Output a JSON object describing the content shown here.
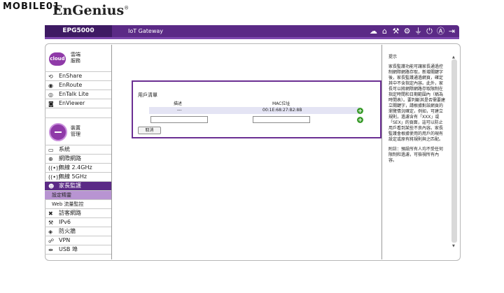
{
  "header": {
    "watermark": "MOBILE01",
    "logo_text": "EnGenius",
    "logo_mark": "®",
    "model": "EPG5000",
    "product": "IoT Gateway",
    "icons": [
      "cloud-download-icon",
      "home-icon",
      "tools-icon",
      "gear-icon",
      "plug-icon",
      "power-icon",
      "circled-a-icon",
      "logout-icon"
    ]
  },
  "sidebar": {
    "cloud_section": {
      "badge": "cloud",
      "title_line1": "雲端",
      "title_line2": "服務"
    },
    "cloud_items": [
      {
        "label": "EnShare",
        "icon": "share-icon"
      },
      {
        "label": "EnRoute",
        "icon": "route-icon"
      },
      {
        "label": "EnTalk Lite",
        "icon": "talk-icon"
      },
      {
        "label": "EnViewer",
        "icon": "camera-icon"
      }
    ],
    "device_section": {
      "title_line1": "裝置",
      "title_line2": "管理"
    },
    "device_items": [
      {
        "label": "系統",
        "icon": "monitor-icon"
      },
      {
        "label": "網際網路",
        "icon": "globe-icon"
      },
      {
        "label": "無線 2.4GHz",
        "icon": "wireless-icon"
      },
      {
        "label": "無線 5GHz",
        "icon": "wireless-icon"
      }
    ],
    "active_item": {
      "label": "家長監護",
      "icon": "users-icon"
    },
    "sub_items": [
      {
        "label": "設定精靈",
        "selected": true
      },
      {
        "label": "Web 流量監控",
        "selected": false
      }
    ],
    "more_items": [
      {
        "label": "訪客網路",
        "icon": "wrench-icon"
      },
      {
        "label": "IPv6",
        "icon": "tools-icon"
      },
      {
        "label": "防火牆",
        "icon": "firewall-icon"
      },
      {
        "label": "VPN",
        "icon": "vpn-icon"
      },
      {
        "label": "USB 埠",
        "icon": "usb-icon"
      }
    ]
  },
  "dialog": {
    "title": "用戶清單",
    "col_desc": "描述",
    "col_mac": "MAC位址",
    "row": {
      "desc": "---",
      "mac": "00:1E:68:27:B2:8B"
    },
    "cancel_label": "取消"
  },
  "help": {
    "title": "提示",
    "paragraph1": "家長監護功能可讓家長通過控制網際網路存取，新增關鍵字後，家長監護通過網頁，確定其中不含指定內容。此外，家長可以將網際網路存取限制在指定時間和日期範圍內（稱為時間表）。要判斷其是否需要建立關鍵字，請根據對該網頁的瀏覽情況確定，例如，可建立規則，過濾含有「XXX」或「SEX」的頁面，這可以防止用戶看到某些不良內容。家長監護會根據使用的用戶的現有設定或原有將規則與之匹配。",
    "paragraph2": "附註：預設所有人均不受任何限制和過濾，可檢視所有內容。"
  },
  "colors": {
    "brand": "#5b2a86",
    "accent": "#7d48ad",
    "badge": "#8f3aa8",
    "add_button": "#3a9b2c"
  }
}
